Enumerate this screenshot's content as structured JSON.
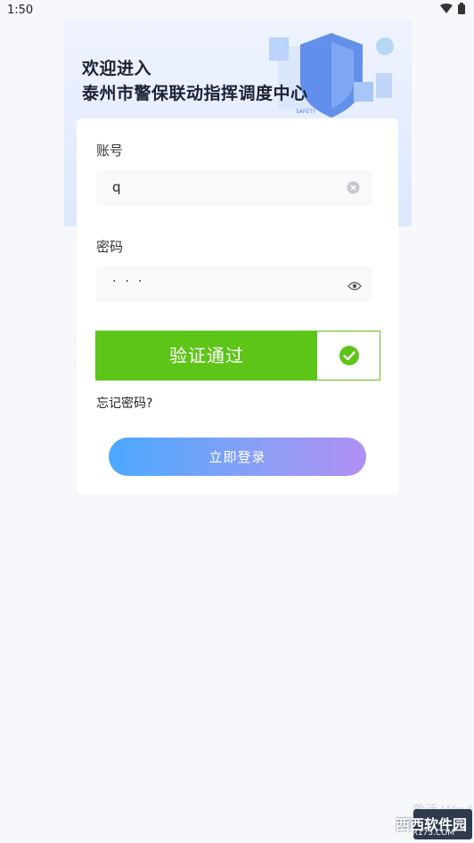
{
  "status_bar": {
    "time": "1:50"
  },
  "banner": {
    "line1": "欢迎进入",
    "line2": "泰州市警保联动指挥调度中心",
    "art_caption": "SAFETY"
  },
  "form": {
    "account_label": "账号",
    "account_value": "q",
    "password_label": "密码",
    "password_masked": "···",
    "verify_text": "验证通过",
    "forgot_link": "忘记密码?",
    "login_button": "立即登录"
  },
  "colors": {
    "verify_green": "#5dc418",
    "gradient_start": "#4aa9ff",
    "gradient_end": "#b08ff4"
  },
  "watermark": {
    "text": "激活 Wind",
    "brand": "西西软件园",
    "domain": "CR173.COM"
  },
  "icons": [
    "wifi-icon",
    "battery-icon",
    "clear-icon",
    "eye-icon",
    "check-circle-icon"
  ]
}
